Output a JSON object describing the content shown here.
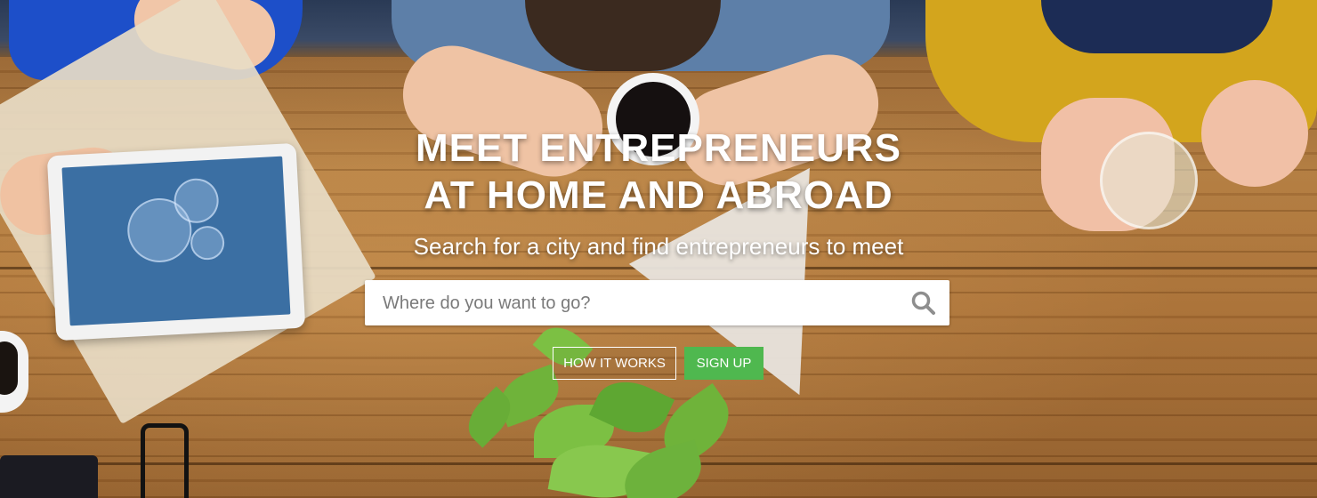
{
  "hero": {
    "title_line1": "MEET ENTREPRENEURS",
    "title_line2": "AT HOME AND ABROAD",
    "subtitle": "Search for a city and find entrepreneurs to meet"
  },
  "search": {
    "placeholder": "Where do you want to go?",
    "value": "",
    "icon": "search-icon"
  },
  "actions": {
    "how_it_works_label": "HOW IT WORKS",
    "sign_up_label": "SIGN UP"
  },
  "colors": {
    "sign_up_bg": "#4fb84f",
    "text": "#ffffff"
  }
}
